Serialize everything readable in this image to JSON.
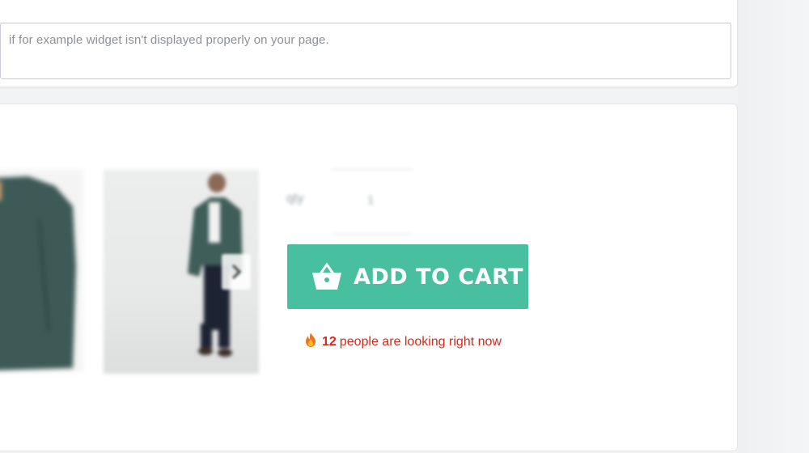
{
  "notice": {
    "text": "if for example widget isn't displayed properly on your page."
  },
  "product": {
    "quantity": {
      "label": "qty",
      "value": "1"
    },
    "add_to_cart_label": "ADD TO CART",
    "social_proof": {
      "count": "12",
      "text": "people are looking right now"
    }
  },
  "colors": {
    "button": "#48bf9e",
    "social_proof": "#d12a1c"
  },
  "icons": [
    "basket-icon",
    "fire-icon",
    "chevron-right-icon"
  ]
}
